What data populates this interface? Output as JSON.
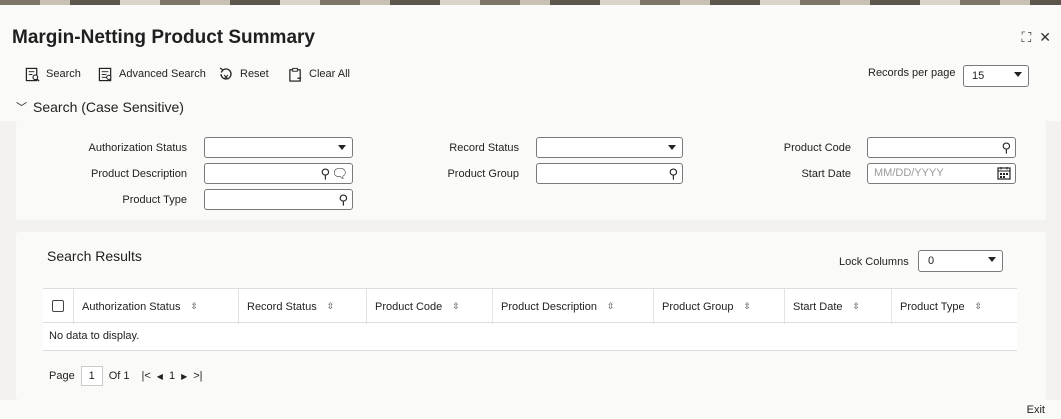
{
  "window": {
    "title": "Margin-Netting Product Summary",
    "close_glyph": "✕",
    "resize_glyph": "⛶"
  },
  "toolbar": {
    "search": "Search",
    "advanced_search": "Advanced Search",
    "reset": "Reset",
    "clear_all": "Clear All",
    "records_per_page_label": "Records per page",
    "records_per_page_value": "15"
  },
  "search_section": {
    "title": "Search (Case Sensitive)",
    "fields": {
      "authorization_status": {
        "label": "Authorization Status",
        "value": ""
      },
      "record_status": {
        "label": "Record Status",
        "value": ""
      },
      "product_code": {
        "label": "Product Code",
        "value": ""
      },
      "product_description": {
        "label": "Product Description",
        "value": ""
      },
      "product_group": {
        "label": "Product Group",
        "value": ""
      },
      "start_date": {
        "label": "Start Date",
        "placeholder": "MM/DD/YYYY"
      },
      "product_type": {
        "label": "Product Type",
        "value": ""
      }
    }
  },
  "results": {
    "title": "Search Results",
    "lock_columns_label": "Lock Columns",
    "lock_columns_value": "0",
    "columns": [
      "Authorization Status",
      "Record Status",
      "Product Code",
      "Product Description",
      "Product Group",
      "Start Date",
      "Product Type"
    ],
    "empty_message": "No data to display.",
    "pager": {
      "page_label": "Page",
      "page_value": "1",
      "of_label": "Of 1",
      "current": "1"
    }
  },
  "footer": {
    "exit": "Exit"
  }
}
